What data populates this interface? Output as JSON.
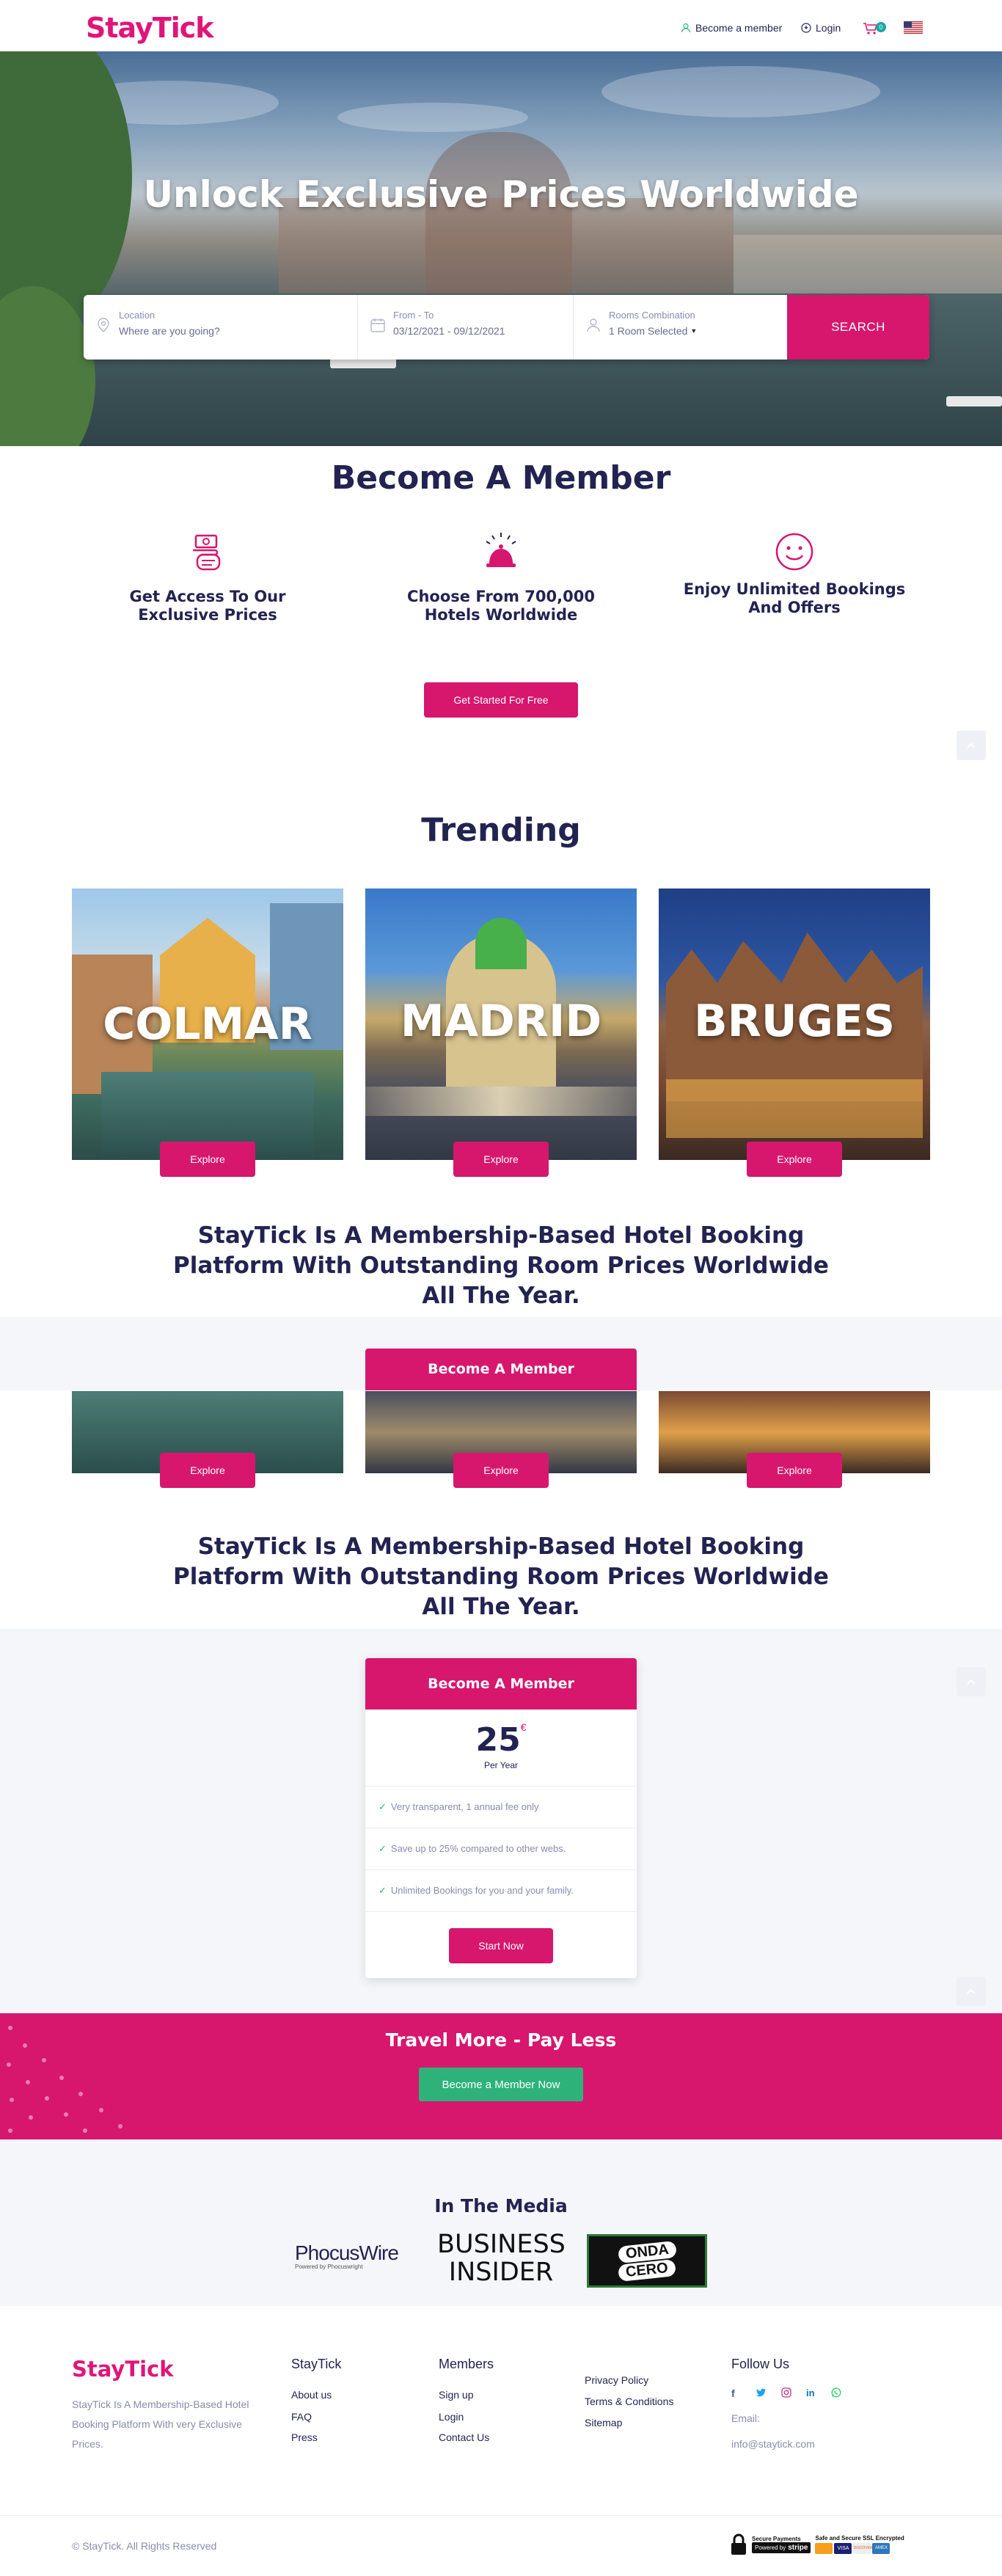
{
  "header": {
    "logo": "StayTick",
    "become_member": "Become a member",
    "login": "Login",
    "cart_count": "0"
  },
  "hero": {
    "title": "Unlock Exclusive Prices Worldwide",
    "location_label": "Location",
    "location_placeholder": "Where are you going?",
    "dates_label": "From - To",
    "dates_value": "03/12/2021 - 09/12/2021",
    "rooms_label": "Rooms Combination",
    "rooms_value": "1 Room Selected",
    "search_button": "SEARCH"
  },
  "become_member": {
    "title": "Become A Member",
    "features": [
      {
        "text": "Get Access To Our Exclusive Prices",
        "icon": "money-hand-icon"
      },
      {
        "text": "Choose From 700,000 Hotels Worldwide",
        "icon": "service-bell-icon"
      },
      {
        "text": "Enjoy Unlimited Bookings And Offers",
        "icon": "smiley-icon"
      }
    ],
    "cta": "Get Started For Free"
  },
  "trending": {
    "title": "Trending",
    "cities": [
      {
        "name": "COLMAR",
        "button": "Explore"
      },
      {
        "name": "MADRID",
        "button": "Explore"
      },
      {
        "name": "BRUGES",
        "button": "Explore"
      }
    ]
  },
  "tagline": "StayTick Is A Membership-Based Hotel Booking Platform With Outstanding Room Prices Worldwide All The Year.",
  "overlay_member_header": "Become A Member",
  "repeat_explore": [
    "Explore",
    "Explore",
    "Explore"
  ],
  "tagline_2": "StayTick Is A Membership-Based Hotel Booking Platform With Outstanding Room Prices Worldwide All The Year.",
  "pricing": {
    "header": "Become A Member",
    "price": "25",
    "currency": "€",
    "period": "Per Year",
    "features": [
      "Very transparent, 1 annual fee only",
      "Save up to 25% compared to other webs.",
      "Unlimited Bookings for you and your family."
    ],
    "button": "Start Now"
  },
  "promo": {
    "title": "Travel More - Pay Less",
    "button": "Become a Member Now"
  },
  "media": {
    "title": "In The Media",
    "logos": [
      "PhocusWire",
      "Powered by Phocuswright",
      "BUSINESS",
      "INSIDER",
      "ONDA",
      "CERO"
    ]
  },
  "footer": {
    "logo": "StayTick",
    "description": "StayTick Is A Membership-Based Hotel Booking Platform With very Exclusive Prices.",
    "col1_title": "StayTick",
    "col1_links": [
      "About us",
      "FAQ",
      "Press"
    ],
    "col2_title": "Members",
    "col2_links": [
      "Sign up",
      "Login",
      "Contact Us"
    ],
    "col3_links": [
      "Privacy Policy",
      "Terms & Conditions",
      "Sitemap"
    ],
    "follow_title": "Follow Us",
    "email_label": "Email:",
    "email": "info@staytick.com",
    "copyright": "© StayTick. All Rights Reserved",
    "badge_secure_payments": "Secure Payments",
    "badge_powered_by": "Powered by",
    "badge_stripe": "stripe",
    "badge_ssl": "Safe and Secure SSL Encrypted",
    "badge_cards": [
      "VISA",
      "DISCOVER",
      "AMEX"
    ]
  },
  "colors": {
    "accent": "#d6176d",
    "navy": "#232352",
    "green": "#2db37a",
    "light_bg": "#f5f6fa"
  }
}
